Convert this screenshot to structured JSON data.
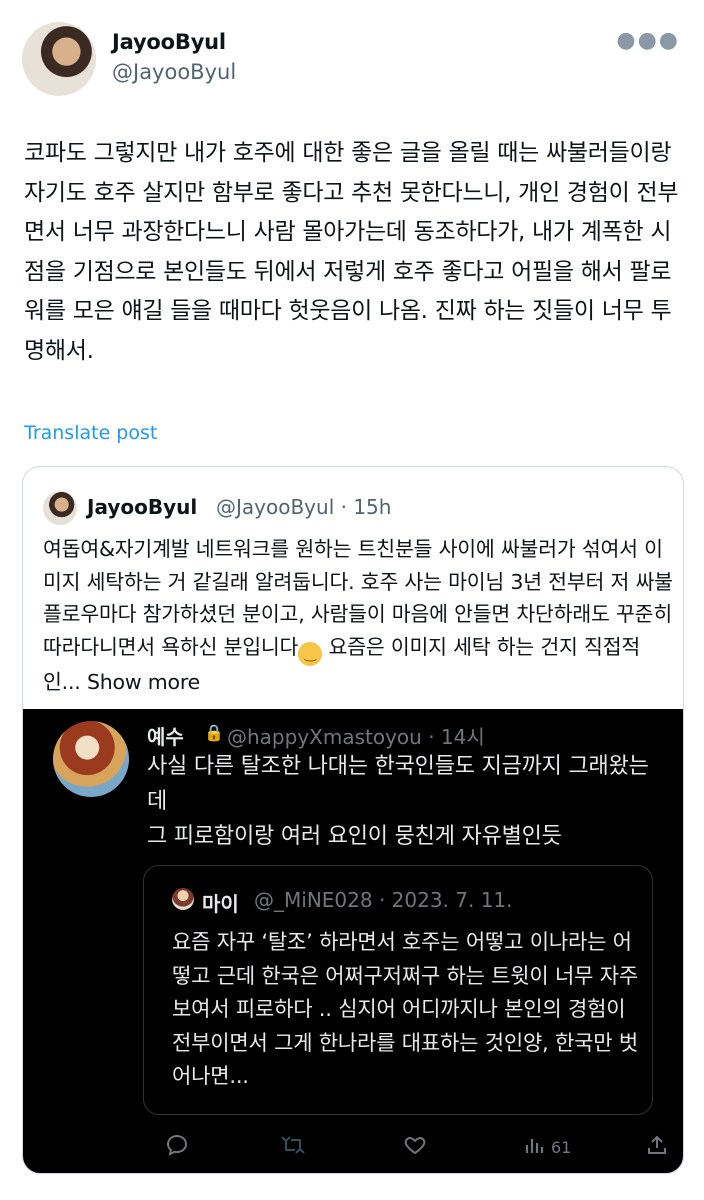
{
  "author": {
    "display_name": "JayooByul",
    "handle": "@JayooByul"
  },
  "tweet": {
    "text": "코파도 그렇지만 내가 호주에 대한 좋은 글을 올릴 때는 싸불러들이랑 자기도 호주 살지만 함부로 좋다고 추천 못한다느니, 개인 경험이 전부면서 너무 과장한다느니 사람 몰아가는데 동조하다가, 내가 계폭한 시점을 기점으로 본인들도 뒤에서 저렇게 호주 좋다고 어필을 해서 팔로워를 모은 얘길 들을 때마다 헛웃음이 나옴. 진짜 하는 짓들이 너무 투명해서.",
    "translate_label": "Translate post"
  },
  "quoted": {
    "display_name": "JayooByul",
    "meta": "@JayooByul · 15h",
    "text_before_emoji": "여돕여&자기계발 네트워크를 원하는 트친분들 사이에 싸불러가 섞여서 이미지 세탁하는 거 같길래 알려둡니다. 호주 사는 마이님 3년 전부터 저 싸불 플로우마다 참가하셨던 분이고, 사람들이 마음에 안들면 차단하래도 꾸준히 따라다니면서 욕하신 분입니다",
    "text_after_emoji": " 요즘은 이미지 세탁 하는 건지 직접적인... ",
    "show_more": "Show more"
  },
  "screenshot": {
    "display_name": "예수",
    "meta": "@happyXmastoyou · 14시",
    "text": "사실 다른 탈조한 나대는 한국인들도 지금까지 그래왔는데\n그 피로함이랑 여러 요인이 뭉친게 자유별인듯",
    "inner": {
      "display_name": "마이",
      "meta": "@_MiNE028 · 2023. 7. 11.",
      "text": "요즘 자꾸 ‘탈조’ 하라면서 호주는 어떻고 이나라는 어떻고 근데 한국은 어쩌구저쩌구 하는 트윗이 너무 자주 보여서 피로하다 .. 심지어 어디까지나 본인의 경험이 전부이면서 그게 한나라를 대표하는 것인양, 한국만 벗어나면..."
    },
    "actions": {
      "views": "61"
    }
  },
  "colors": {
    "link_blue": "#1d9bf0",
    "secondary_text": "#536471",
    "dark_bg": "#000000"
  },
  "icons": [
    "more-icon",
    "lock-icon",
    "reply-icon",
    "retweet-icon",
    "like-icon",
    "views-icon",
    "share-icon",
    "smile-emoji"
  ]
}
